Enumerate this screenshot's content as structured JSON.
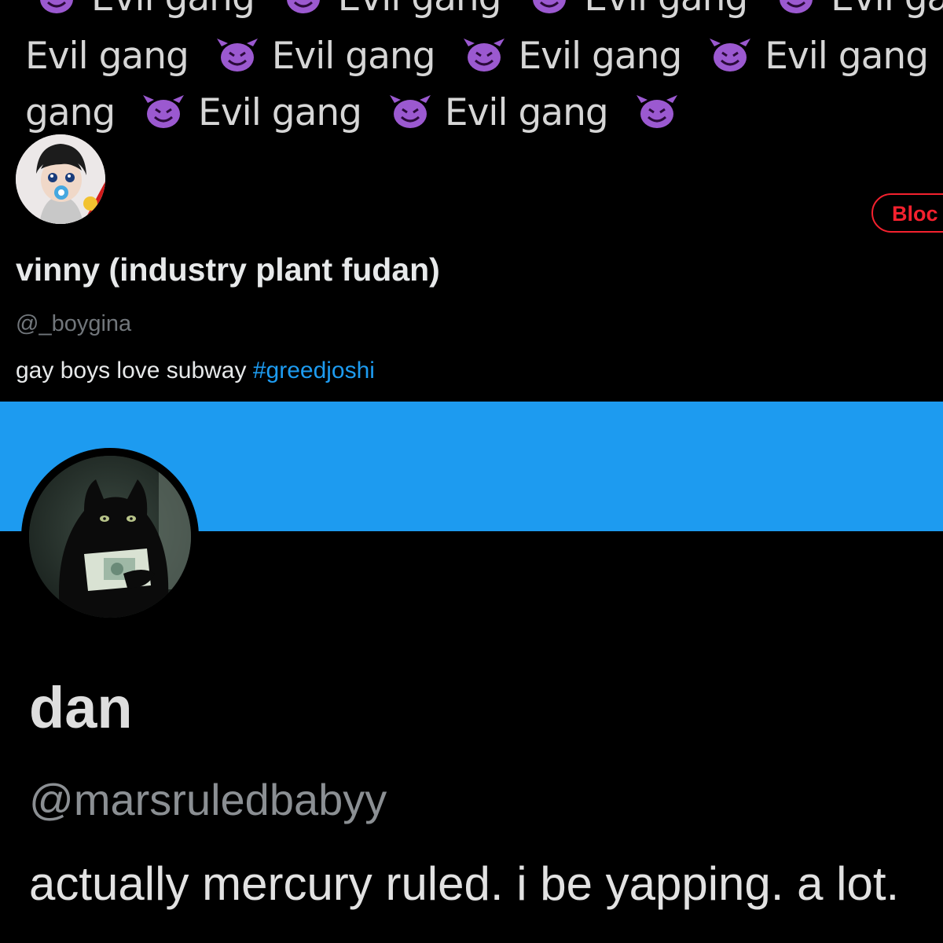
{
  "banner": {
    "phrase": "Evil gang",
    "icon": "smiling-imp-emoji",
    "icon_color": "#9b59d0",
    "line_top": [
      "Evil gang",
      "Evil gang",
      "Evil gang",
      "Evil ga"
    ],
    "line_middle": [
      "Evil gang",
      "Evil gang",
      "Evil gang",
      "Evil gang"
    ],
    "line_bottom": [
      "gang",
      "Evil gang",
      "Evil gang"
    ]
  },
  "profile1": {
    "display_name": "vinny (industry plant fudan)",
    "handle": "@_boygina",
    "bio_text": "gay boys love subway ",
    "bio_hashtag": "#greedjoshi",
    "block_label": "Bloc"
  },
  "profile2": {
    "banner_color": "#1d9bf0",
    "display_name": "dan",
    "handle": "@marsruledbabyy",
    "bio": "actually mercury ruled. i be yapping. a lot."
  },
  "colors": {
    "background": "#000000",
    "link": "#1d9bf0",
    "danger": "#f4212e",
    "muted": "#71767b"
  }
}
